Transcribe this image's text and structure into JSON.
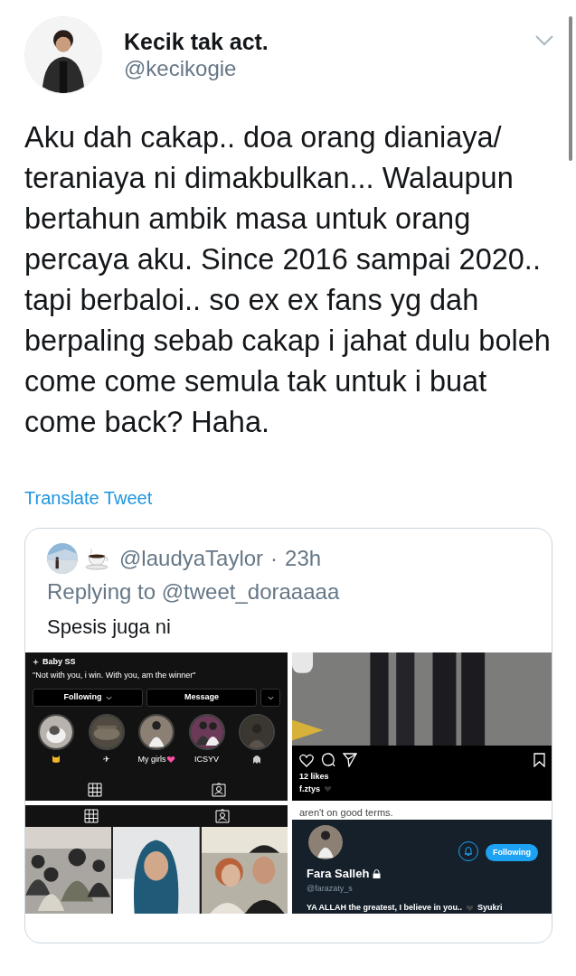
{
  "author": {
    "name": "Kecik tak act.",
    "handle": "@kecikogie"
  },
  "tweet_text": "Aku dah cakap.. doa orang dianiaya/ teraniaya ni dimakbulkan... Walaupun bertahun ambik masa untuk orang percaya aku. Since 2016 sampai 2020.. tapi berbaloi.. so ex ex fans yg dah berpaling sebab cakap i jahat dulu boleh come come semula tak untuk i buat come back? Haha.",
  "translate_link": "Translate Tweet",
  "quoted_tweet": {
    "handle": "@laudyaTaylor",
    "separator": "·",
    "time": "23h",
    "replying_to": "Replying to @tweet_doraaaaa",
    "text": "Spesis juga ni",
    "media": [
      {
        "kind": "instagram_profile",
        "name": "Baby SS",
        "bio": "\"Not with you, i win. With you, am the winner\"",
        "buttons": [
          "Following",
          "Message"
        ],
        "highlights": [
          {
            "kind": "icon"
          },
          {
            "kind": "glyph",
            "label": "✈"
          },
          {
            "kind": "text_heart",
            "label": "My girls"
          },
          {
            "kind": "text",
            "label": "ICSYV"
          },
          {
            "kind": "icon"
          }
        ]
      },
      {
        "kind": "instagram_post",
        "likes": "12 likes",
        "username": "f.ztys"
      },
      {
        "kind": "instagram_grid"
      },
      {
        "kind": "twitter_profile",
        "caption_fragment": "aren't on good terms.",
        "follow_button": "Following",
        "name": "Fara Salleh",
        "handle": "@farazaty_s",
        "bio_start": "YA ALLAH the greatest, I believe in you..",
        "bio_end": "Syukri"
      }
    ]
  }
}
